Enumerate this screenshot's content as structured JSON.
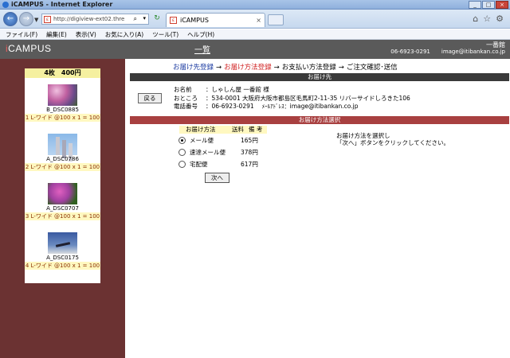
{
  "window": {
    "title": "iCAMPUS - Internet Explorer"
  },
  "browser": {
    "url": "http://digiview-ext02.thre",
    "tab_label": "iCAMPUS",
    "tab_close": "×"
  },
  "menu": [
    "ファイル(F)",
    "編集(E)",
    "表示(V)",
    "お気に入り(A)",
    "ツール(T)",
    "ヘルプ(H)"
  ],
  "site": {
    "logo_i": "i",
    "logo_rest": "CAMPUS",
    "list_link": "一覧",
    "shop_name": "一番館",
    "shop_phone": "06-6923-0291",
    "shop_email": "image@itibankan.co.jp"
  },
  "cart": {
    "header": "4枚　400円",
    "items": [
      {
        "code": "B_DSC0885",
        "spec": "1 L-ワイド @100 x 1 = 100"
      },
      {
        "code": "A_DSC0786",
        "spec": "2 L-ワイド @100 x 1 = 100"
      },
      {
        "code": "A_DSC0707",
        "spec": "3 L-ワイド @100 x 1 = 100"
      },
      {
        "code": "A_DSC0175",
        "spec": "4 L-ワイド @100 x 1 = 100"
      }
    ]
  },
  "steps": {
    "s1": "お届け先登録",
    "s2": "お届け方法登録",
    "s3": "お支払い方法登録",
    "s4": "ご注文確認･送信",
    "arrow": "→"
  },
  "destination": {
    "section_title": "お届け先",
    "back_button": "戻る",
    "name_label": "お名前",
    "name_value": "：しゃしん屋 一番館 様",
    "address_label": "おところ",
    "address_value": "：534-0001  大阪府大阪市都島区毛馬町2-11-35 リバーサイドしろきた106",
    "phone_label": "電話番号",
    "phone_value": "：06-6923-0291",
    "mail_label": "ﾒｰﾙｱﾄﾞﾚｽ：",
    "mail_value": "image@itibankan.co.jp"
  },
  "shipping": {
    "section_title": "お届け方法選択",
    "col_method": "お届け方法",
    "col_fee": "送料",
    "col_note": "備  考",
    "options": [
      {
        "name": "メール便",
        "price": "165円",
        "selected": true
      },
      {
        "name": "速達メール便",
        "price": "378円",
        "selected": false
      },
      {
        "name": "宅配便",
        "price": "617円",
        "selected": false
      }
    ],
    "next_button": "次へ",
    "note_line1": "お届け方法を選択し",
    "note_line2": "「次へ」ボタンをクリックしてください。"
  }
}
